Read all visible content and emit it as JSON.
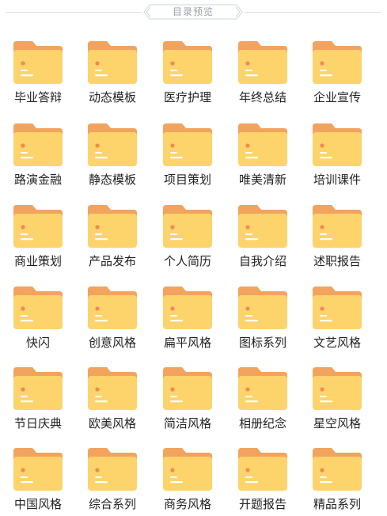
{
  "header": {
    "title": "目录预览"
  },
  "colors": {
    "folder_back": "#f2a35e",
    "folder_front": "#fdd36b",
    "folder_dot": "#f08a52",
    "folder_line": "#ffffff"
  },
  "items": [
    {
      "label": "毕业答辩"
    },
    {
      "label": "动态模板"
    },
    {
      "label": "医疗护理"
    },
    {
      "label": "年终总结"
    },
    {
      "label": "企业宣传"
    },
    {
      "label": "路演金融"
    },
    {
      "label": "静态模板"
    },
    {
      "label": "项目策划"
    },
    {
      "label": "唯美清新"
    },
    {
      "label": "培训课件"
    },
    {
      "label": "商业策划"
    },
    {
      "label": "产品发布"
    },
    {
      "label": "个人简历"
    },
    {
      "label": "自我介绍"
    },
    {
      "label": "述职报告"
    },
    {
      "label": "快闪"
    },
    {
      "label": "创意风格"
    },
    {
      "label": "扁平风格"
    },
    {
      "label": "图标系列"
    },
    {
      "label": "文艺风格"
    },
    {
      "label": "节日庆典"
    },
    {
      "label": "欧美风格"
    },
    {
      "label": "简洁风格"
    },
    {
      "label": "相册纪念"
    },
    {
      "label": "星空风格"
    },
    {
      "label": "中国风格"
    },
    {
      "label": "综合系列"
    },
    {
      "label": "商务风格"
    },
    {
      "label": "开题报告"
    },
    {
      "label": "精品系列"
    }
  ]
}
